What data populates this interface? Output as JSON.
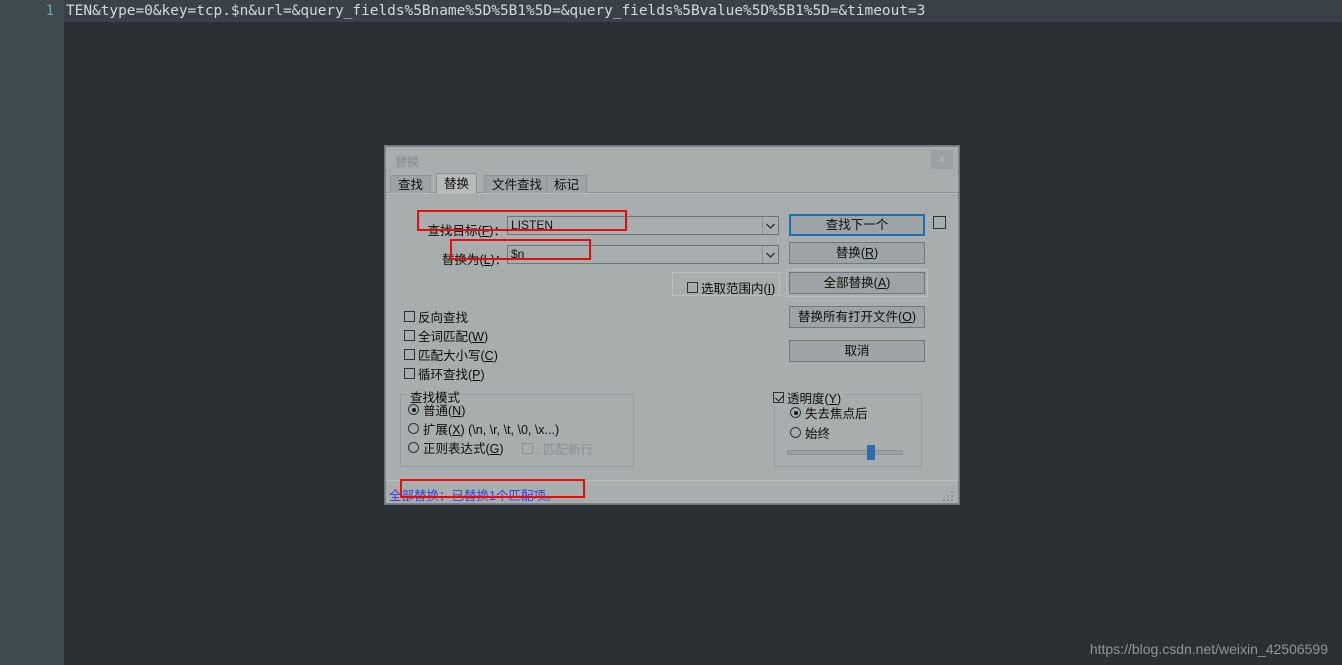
{
  "editor": {
    "line_number": "1",
    "code_line": "TEN&type=0&key=tcp.$n&url=&query_fields%5Bname%5D%5B1%5D=&query_fields%5Bvalue%5D%5B1%5D=&timeout=3",
    "watermark": "https://blog.csdn.net/weixin_42506599"
  },
  "dialog": {
    "title": "替换",
    "close_label": "×",
    "tabs": [
      {
        "label": "查找",
        "active": false
      },
      {
        "label": "替换",
        "active": true
      },
      {
        "label": "文件查找",
        "active": false
      },
      {
        "label": "标记",
        "active": false
      }
    ],
    "fields": {
      "find_label": "查找目标(F)：",
      "find_value": "LISTEN",
      "replace_label": "替换为(L)：",
      "replace_value": "$n"
    },
    "buttons": {
      "find_next": "查找下一个",
      "replace": "替换(R)",
      "replace_all": "全部替换(A)",
      "replace_all_open_files": "替换所有打开文件(O)",
      "cancel": "取消"
    },
    "checkboxes": {
      "in_selection": {
        "label": "选取范围内(I)",
        "checked": false
      },
      "backward": {
        "label": "反向查找",
        "checked": false
      },
      "whole_word": {
        "label": "全词匹配(W)",
        "checked": false
      },
      "match_case": {
        "label": "匹配大小写(C)",
        "checked": false
      },
      "wrap_around": {
        "label": "循环查找(P)",
        "checked": false
      },
      "dot_matches_newline": {
        "label": ". 匹配新行",
        "checked": false,
        "disabled": true
      },
      "transparency": {
        "label": "透明度(Y)",
        "checked": true
      }
    },
    "search_mode": {
      "title": "查找模式",
      "options": [
        {
          "label": "普通(N)",
          "selected": true
        },
        {
          "label": "扩展(X) (\\n, \\r, \\t, \\0, \\x...)",
          "selected": false
        },
        {
          "label": "正则表达式(G)",
          "selected": false
        }
      ]
    },
    "transparency_group": {
      "options": [
        {
          "label": "失去焦点后",
          "selected": true
        },
        {
          "label": "始终",
          "selected": false
        }
      ],
      "slider_percent": 73
    },
    "status": "全部替换：已替换1个匹配项。"
  },
  "colors": {
    "accent_focus": "#1f6eb5",
    "annotation": "#e80d0d",
    "status_text": "#3c3cdc",
    "dialog_bg": "#a8adae",
    "editor_bg": "#2b3034"
  }
}
